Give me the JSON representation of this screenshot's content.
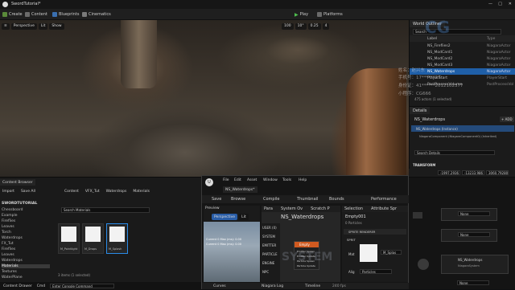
{
  "window": {
    "title": "SwordTutorial*",
    "controls": [
      "—",
      "□",
      "✕"
    ]
  },
  "toolbar": {
    "create": "Create",
    "content": "Content",
    "blueprints": "Blueprints",
    "cinematics": "Cinematics",
    "play": "Play",
    "platforms": "Platforms",
    "accent": "#2a8be8"
  },
  "viewport": {
    "perspective": "Perspective",
    "lit": "Lit",
    "show": "Show",
    "grid_value": "100",
    "angle_value": "10°",
    "scale_value": "0.25",
    "speed_value": "4"
  },
  "outliner": {
    "title": "World Outliner",
    "search_placeholder": "Search",
    "col_label": "Label",
    "col_type": "Type",
    "rows": [
      {
        "name": "NS_Fireflies2",
        "type": "NiagaraActor"
      },
      {
        "name": "NS_ModCard1",
        "type": "NiagaraActor"
      },
      {
        "name": "NS_ModCard2",
        "type": "NiagaraActor"
      },
      {
        "name": "NS_ModCard3",
        "type": "NiagaraActor"
      },
      {
        "name": "NS_Waterdrops",
        "type": "NiagaraActor"
      },
      {
        "name": "PlayerStart",
        "type": "PlayerStart"
      },
      {
        "name": "PostProcessVolume",
        "type": "PostProcessVol"
      }
    ],
    "selected_row": "NS_Waterdrops",
    "status": "475 actors (1 selected)"
  },
  "details": {
    "title": "Details",
    "actor_name": "NS_Waterdrops",
    "add_label": "+ ADD",
    "instance_row": "NS_Waterdrops (Instance)",
    "component_row": "NiagaraComponent (NiagaraComponent0) (Inherited)",
    "search_placeholder": "Search Details",
    "section_transform": "TRANSFORM",
    "location_label": "Location",
    "rotation_label": "Rotation",
    "scale_label": "Scale",
    "location": [
      "-1997.2936",
      "-13233.986",
      "3060.79280"
    ],
    "rotation": [
      "0.0°",
      "0.0°",
      "0.0°"
    ],
    "scale": [
      "1.0",
      "1.0",
      "1.0"
    ]
  },
  "content_browser": {
    "title": "Content Browser",
    "import": "Import",
    "save_all": "Save All",
    "breadcrumb": [
      "Content",
      "VFX_Tut",
      "Waterdrops",
      "Materials"
    ],
    "filter_placeholder": "Search Materials",
    "tree_root": "SWORDTUTORIAL",
    "tree": [
      "Chessboard",
      "Example",
      "Fireflies",
      "Leaves",
      "Torch",
      "Waterdrops",
      "FX_Tut",
      "Fireflies",
      "Leaves",
      "Waterdrops",
      "Materials",
      "Textures",
      "WaterPlane"
    ],
    "selected_folder": "Materials",
    "assets": [
      "M_Pointlight",
      "M_Drops",
      "M_Splash"
    ],
    "selected_asset": "M_Splash",
    "status": "3 items (1 selected)",
    "content_drawer": "Content Drawer",
    "cmd": "Cmd",
    "console_placeholder": "Enter Console Command"
  },
  "niagara": {
    "tab_title": "NS_Waterdrops*",
    "menu": [
      "File",
      "Edit",
      "Asset",
      "Window",
      "Tools",
      "Help"
    ],
    "toolbar": [
      "Save",
      "Browse",
      "Compile",
      "Thumbnail",
      "Bounds",
      "Performance"
    ],
    "preview_tab": "Preview",
    "preview_perspective": "Perspective",
    "preview_lit": "Lit",
    "preview_stats": [
      "Current 0 Max (ms): 0.00",
      "Current 0 Max (ms): 0.00"
    ],
    "params_tab": "Para",
    "system_overview_tab": "System Ov",
    "scratch_tab": "Scratch P",
    "system_name": "NS_Waterdrops",
    "param_groups": [
      "USER (0)",
      "SYSTEM",
      "EMITTER",
      "PARTICLE",
      "ENGINE",
      "NPC"
    ],
    "emitter_node": "Empty",
    "emitter_stages": [
      "Emitter Spawn",
      "Emitter Update",
      "Particle Spawn",
      "Particle Update"
    ],
    "selection_tab": "Selection",
    "attr_tab": "Attribute Spr",
    "selected_emitter": "Empty001",
    "particles_count": "0 Particles",
    "sprite_renderer": "SPRITE RENDERER",
    "sprite_section": "SPRIT",
    "mat_label": "Mat",
    "mat_value": "M_Splas",
    "alignment_label": "Alig",
    "alignment_value": "Particles",
    "bottom_tabs": [
      "Curves",
      "Niagara Log",
      "Timeline"
    ],
    "fps": "240 fps"
  },
  "right_rack": {
    "none_labels": [
      "None",
      "None",
      "None"
    ],
    "node_label": "NS_Waterdrops",
    "node_type": "NiagaraSystem"
  },
  "watermark": {
    "lines": [
      "姓名：",
      "手机号：",
      "身份证：",
      "小程序："
    ],
    "values": [
      "赵兴东",
      "17******27",
      "41******2012102377",
      "CG666"
    ],
    "logo_text": "SYSTEM"
  }
}
